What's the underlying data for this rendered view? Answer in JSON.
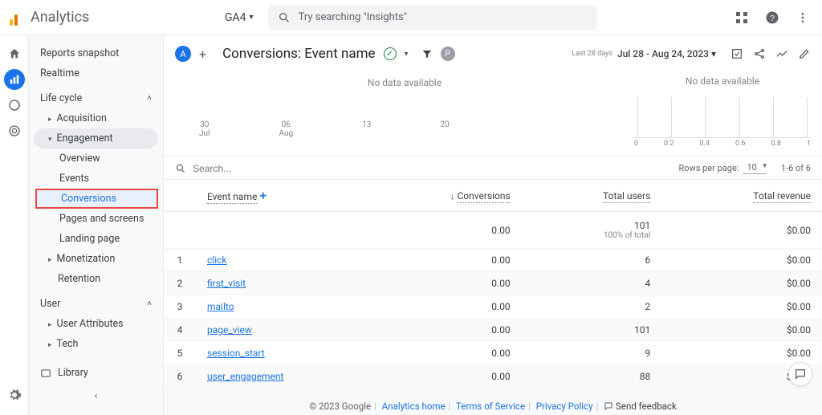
{
  "top": {
    "product": "Analytics",
    "property": "GA4",
    "search_placeholder": "Try searching \"Insights\""
  },
  "sidebar": {
    "snapshot": "Reports snapshot",
    "realtime": "Realtime",
    "lifecycle": "Life cycle",
    "acquisition": "Acquisition",
    "engagement": "Engagement",
    "eng_items": [
      "Overview",
      "Events",
      "Conversions",
      "Pages and screens",
      "Landing page"
    ],
    "monetization": "Monetization",
    "retention": "Retention",
    "user": "User",
    "user_attrs": "User Attributes",
    "tech": "Tech",
    "library": "Library"
  },
  "report": {
    "title": "Conversions: Event name",
    "avatar": "A",
    "chip": "P",
    "date_label": "Last 28 days",
    "date_range": "Jul 28 - Aug 24, 2023"
  },
  "chart": {
    "no_data": "No data available",
    "dates": [
      [
        "30",
        "Jul"
      ],
      [
        "06",
        "Aug"
      ],
      [
        "13",
        ""
      ],
      [
        "20",
        ""
      ]
    ],
    "right_ticks": [
      "0",
      "0.2",
      "0.4",
      "0.6",
      "0.8",
      "1"
    ]
  },
  "table": {
    "search_ph": "Search...",
    "rows_label": "Rows per page:",
    "rows_val": "10",
    "range": "1-6 of 6",
    "cols": [
      "Event name",
      "Conversions",
      "Total users",
      "Total revenue"
    ],
    "totals": {
      "conv": "0.00",
      "users": "101",
      "users_sub": "100% of total",
      "rev": "$0.00"
    },
    "rows": [
      {
        "n": "1",
        "name": "click",
        "conv": "0.00",
        "users": "6",
        "rev": "$0.00"
      },
      {
        "n": "2",
        "name": "first_visit",
        "conv": "0.00",
        "users": "4",
        "rev": "$0.00"
      },
      {
        "n": "3",
        "name": "mailto",
        "conv": "0.00",
        "users": "2",
        "rev": "$0.00"
      },
      {
        "n": "4",
        "name": "page_view",
        "conv": "0.00",
        "users": "101",
        "rev": "$0.00"
      },
      {
        "n": "5",
        "name": "session_start",
        "conv": "0.00",
        "users": "9",
        "rev": "$0.00"
      },
      {
        "n": "6",
        "name": "user_engagement",
        "conv": "0.00",
        "users": "88",
        "rev": "$0.00"
      }
    ]
  },
  "footer": {
    "copyright": "© 2023 Google",
    "links": [
      "Analytics home",
      "Terms of Service",
      "Privacy Policy"
    ],
    "feedback": "Send feedback"
  },
  "chart_data": {
    "type": "bar",
    "title": "Conversions: Event name",
    "left_panel": {
      "no_data": true,
      "x_ticks": [
        "Jul 30",
        "Aug 06",
        "Aug 13",
        "Aug 20"
      ]
    },
    "right_panel": {
      "no_data": true,
      "x_range": [
        0,
        1
      ],
      "x_ticks": [
        0,
        0.2,
        0.4,
        0.6,
        0.8,
        1
      ]
    },
    "table": {
      "columns": [
        "Event name",
        "Conversions",
        "Total users",
        "Total revenue"
      ],
      "totals": {
        "Conversions": 0.0,
        "Total users": 101,
        "Total revenue": 0.0
      },
      "rows": [
        {
          "Event name": "click",
          "Conversions": 0.0,
          "Total users": 6,
          "Total revenue": 0.0
        },
        {
          "Event name": "first_visit",
          "Conversions": 0.0,
          "Total users": 4,
          "Total revenue": 0.0
        },
        {
          "Event name": "mailto",
          "Conversions": 0.0,
          "Total users": 2,
          "Total revenue": 0.0
        },
        {
          "Event name": "page_view",
          "Conversions": 0.0,
          "Total users": 101,
          "Total revenue": 0.0
        },
        {
          "Event name": "session_start",
          "Conversions": 0.0,
          "Total users": 9,
          "Total revenue": 0.0
        },
        {
          "Event name": "user_engagement",
          "Conversions": 0.0,
          "Total users": 88,
          "Total revenue": 0.0
        }
      ]
    }
  }
}
